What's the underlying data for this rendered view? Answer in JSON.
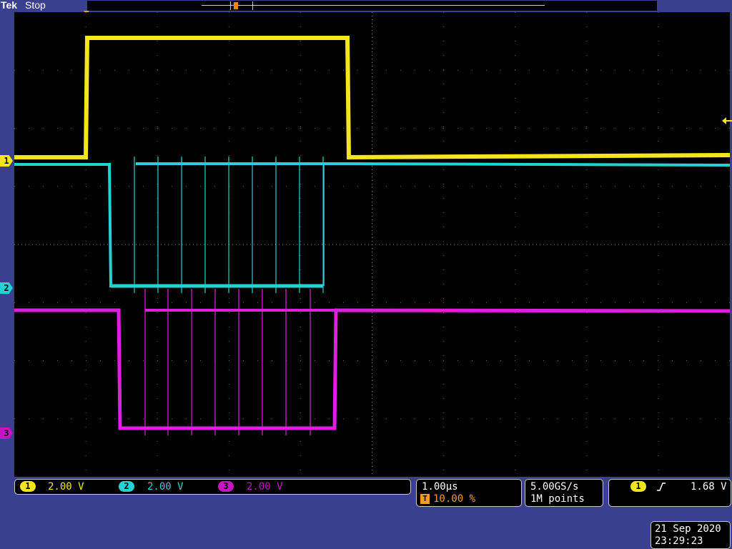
{
  "header": {
    "brand": "Tek",
    "status": "Stop"
  },
  "trigger_marker": {
    "label": "T",
    "color": "#f0a020"
  },
  "channels": [
    {
      "id": "1",
      "scale": "2.00 V",
      "color": "#f5e61c",
      "badge_color": "#f5e61c"
    },
    {
      "id": "2",
      "scale": "2.00 V",
      "color": "#22d3d3",
      "badge_color": "#22d3d3"
    },
    {
      "id": "3",
      "scale": "2.00 V",
      "color": "#e01ee0",
      "badge_color": "#c414c4"
    }
  ],
  "horizontal": {
    "time_per_div": "1.00µs",
    "trigger_position": "10.00 %",
    "trigger_icon": "T"
  },
  "acquisition": {
    "sample_rate": "5.00GS/s",
    "record_length": "1M points"
  },
  "trigger": {
    "source": "1",
    "slope_icon": "rising-edge-icon",
    "level": "1.68 V"
  },
  "datetime": {
    "date": "21 Sep  2020",
    "time": "23:29:23"
  }
}
